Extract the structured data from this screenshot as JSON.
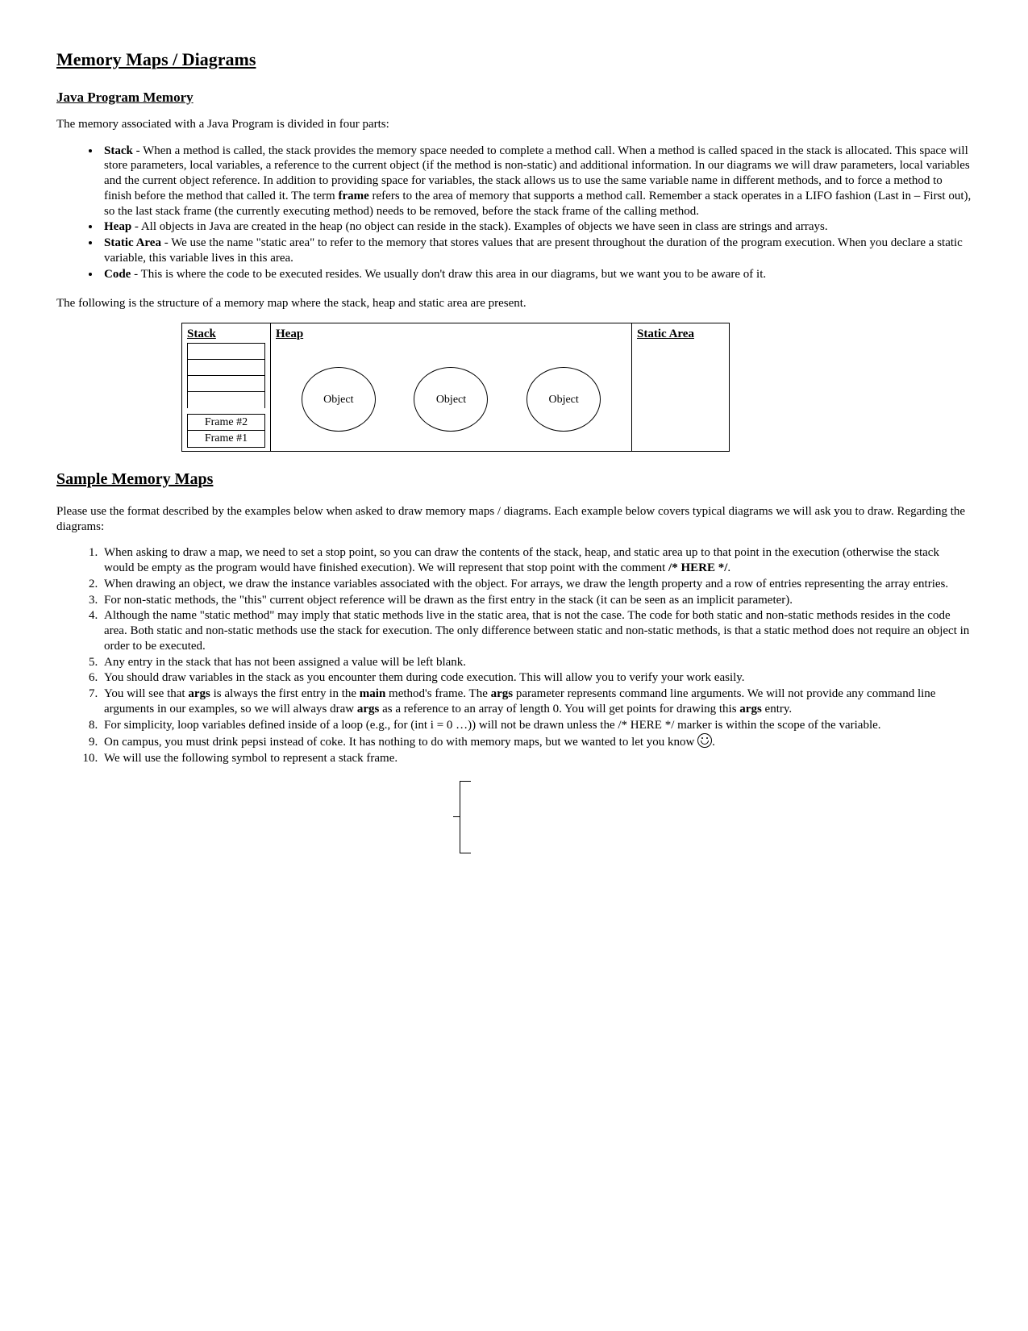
{
  "title": "Memory Maps / Diagrams",
  "s1_head": "Java Program Memory",
  "intro": "The memory associated with a Java Program is divided in four parts:",
  "bullets": {
    "b1_label": "Stack",
    "b1_text": " - When a method is called, the stack provides the memory space needed to complete a method call. When a method is called spaced in the stack is allocated. This space will store parameters, local variables, a reference to the current object (if the method is non-static) and additional information.  In our diagrams we will draw parameters, local variables and the current object reference.  In addition to providing space for variables, the stack allows us to use the same variable name in different methods, and to force a method to finish before the method that called it.  The term ",
    "b1_frame": "frame",
    "b1_text2": " refers to the area of memory that supports a method call.  Remember a stack operates in a LIFO fashion (Last in – First out), so the last stack frame (the currently executing method) needs to be removed, before the stack frame of the calling method.",
    "b2_label": "Heap",
    "b2_text": " - All objects in Java are created in the heap (no object can reside in the stack). Examples of objects we have seen in class are strings and arrays.",
    "b3_label": "Static Area",
    "b3_text": " - We use the name \"static area\" to refer to the memory that stores values that are present throughout the duration of the program execution. When you declare a static variable, this variable lives in this area.",
    "b4_label": "Code",
    "b4_text": " - This is where the code to be executed resides.  We usually don't draw this area in our diagrams, but we want you to be aware of it."
  },
  "after_bullets": "The following is the structure of a memory map where the stack, heap and static area are present.",
  "mm": {
    "stack": "Stack",
    "heap": "Heap",
    "static": "Static Area",
    "obj": "Object",
    "frame2": "Frame #2",
    "frame1": "Frame #1"
  },
  "s2_head": "Sample Memory Maps",
  "s2_intro": "Please use the format described by the examples below when asked to draw memory maps / diagrams.  Each example below covers typical diagrams we will ask you to draw.  Regarding the diagrams:",
  "ol": {
    "n1a": "When asking to draw a map, we need to set a stop point, so you can draw the contents of the stack, heap, and static area up to that point in the execution (otherwise the stack would be empty as the program would have finished execution). We will represent that stop point with the comment ",
    "n1b": "/* HERE */",
    "n1c": ".",
    "n2": "When drawing an object, we draw the instance variables associated with the object.  For arrays, we draw the length property and a row of entries representing the array entries.",
    "n3": "For non-static methods, the \"this\" current object reference will be drawn as the first entry in the stack (it can be seen as an implicit parameter).",
    "n4": "Although the name \"static method\" may imply that static methods live in the static area, that is not the case.  The code for both static and non-static methods resides in the code area.  Both static and non-static methods use the stack for execution.  The only difference between static and non-static methods, is that a static method does not require an object in order to be executed.",
    "n5": "Any entry in the stack that has not been assigned a value will be left blank.",
    "n6": "You should draw variables in the stack as you encounter them during code execution.  This will allow you to verify your work easily.",
    "n7a": "You will see that ",
    "n7b": "args",
    "n7c": " is always the first entry in the ",
    "n7d": "main",
    "n7e": " method's frame. The ",
    "n7f": "args",
    "n7g": " parameter represents command line arguments.  We will not provide any command line arguments in our examples, so we will always draw ",
    "n7h": "args",
    "n7i": " as a reference to an array of length 0.  You will get points for drawing this ",
    "n7j": "args",
    "n7k": " entry.",
    "n8": "For simplicity, loop variables defined inside of a loop (e.g., for (int i = 0 …)) will not be drawn unless the /* HERE */ marker is within the scope of the variable.",
    "n9": "On campus, you must drink pepsi instead of coke.  It has nothing to do with memory maps, but we wanted to let you know ",
    "n9b": ".",
    "n10": "We will use the following symbol to represent a stack frame."
  }
}
